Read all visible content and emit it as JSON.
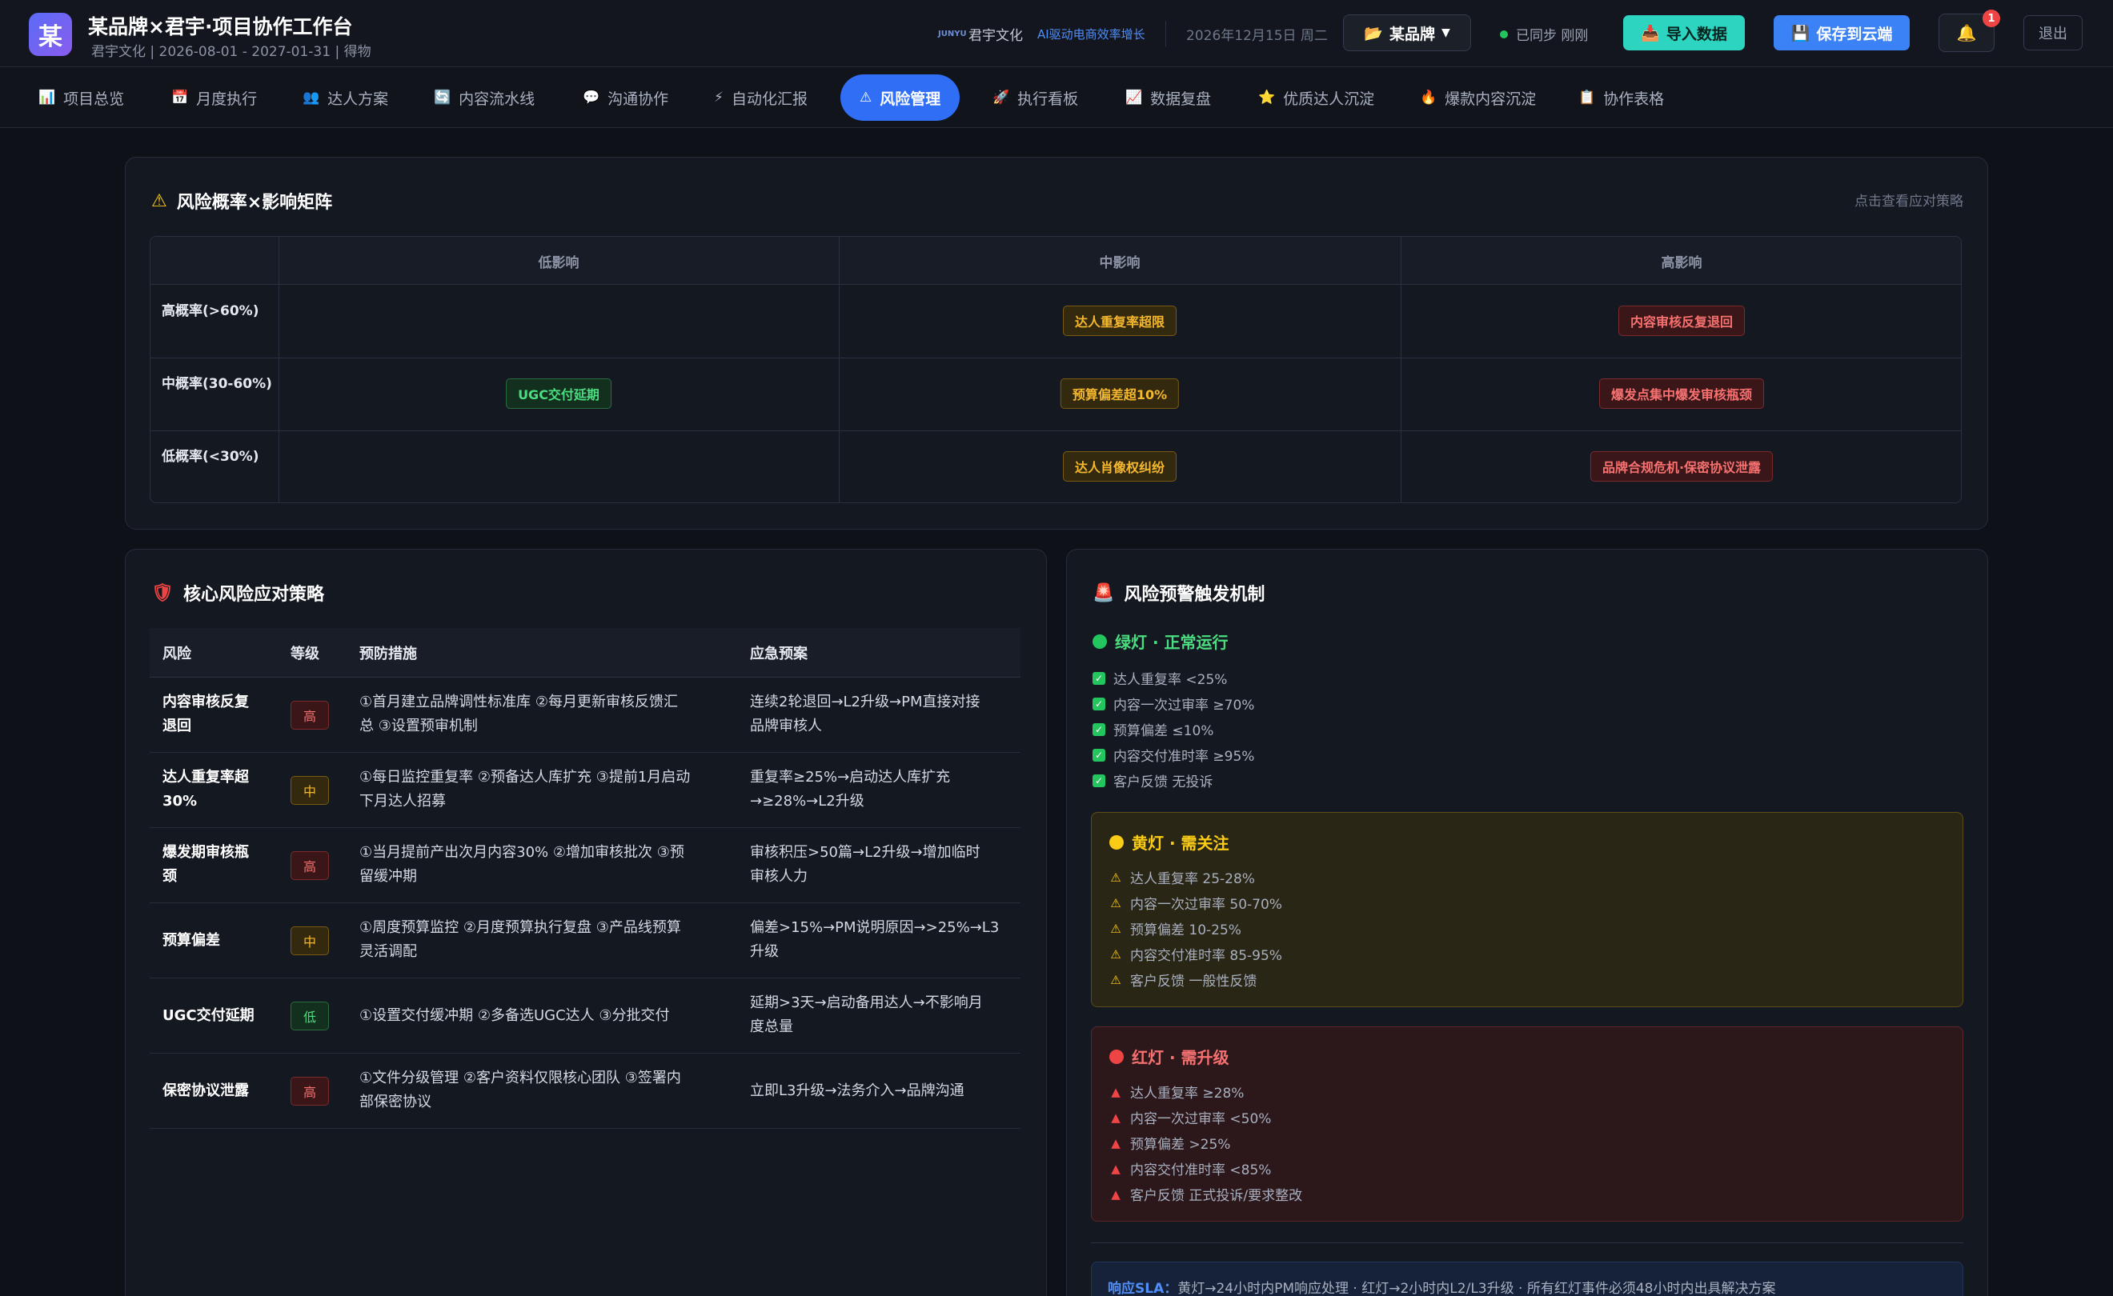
{
  "header": {
    "logo_char": "某",
    "title": "某品牌×君宇·项目协作工作台",
    "subtitle": "君宇文化 | 2026-08-01 - 2027-01-31 | 得物",
    "brand_mini": "JUNYU",
    "company": "君宇文化",
    "tagline": "AI驱动电商效率增长",
    "date": "2026年12月15日 周二",
    "brand_select": "某品牌",
    "sync_status": "已同步 刚刚",
    "import_label": "导入数据",
    "save_label": "保存到云端",
    "notif_count": "1",
    "logout_label": "退出"
  },
  "nav": {
    "tabs": [
      {
        "icon": "📊",
        "label": "项目总览"
      },
      {
        "icon": "📅",
        "label": "月度执行"
      },
      {
        "icon": "👥",
        "label": "达人方案"
      },
      {
        "icon": "🔄",
        "label": "内容流水线"
      },
      {
        "icon": "💬",
        "label": "沟通协作"
      },
      {
        "icon": "⚡",
        "label": "自动化汇报"
      },
      {
        "icon": "⚠",
        "label": "风险管理"
      },
      {
        "icon": "🚀",
        "label": "执行看板"
      },
      {
        "icon": "📈",
        "label": "数据复盘"
      },
      {
        "icon": "⭐",
        "label": "优质达人沉淀"
      },
      {
        "icon": "🔥",
        "label": "爆款内容沉淀"
      },
      {
        "icon": "📋",
        "label": "协作表格"
      }
    ],
    "active_index": 6
  },
  "matrix": {
    "title": "风险概率×影响矩阵",
    "link": "点击查看应对策略",
    "col_headers": [
      "低影响",
      "中影响",
      "高影响"
    ],
    "rows": [
      {
        "label": "高概率(>60%)",
        "cells": [
          "",
          "达人重复率超限",
          "内容审核反复退回"
        ]
      },
      {
        "label": "中概率(30-60%)",
        "cells": [
          "UGC交付延期",
          "预算偏差超10%",
          "爆发点集中爆发审核瓶颈"
        ]
      },
      {
        "label": "低概率(<30%)",
        "cells": [
          "",
          "达人肖像权纠纷",
          "品牌合规危机·保密协议泄露"
        ]
      }
    ]
  },
  "strategy": {
    "title": "核心风险应对策略",
    "headers": [
      "风险",
      "等级",
      "预防措施",
      "应急预案"
    ],
    "rows": [
      {
        "risk_l1": "内容审核反复",
        "risk_l2": "退回",
        "level": "高",
        "level_class": "high",
        "prev_l1": "①首月建立品牌调性标准库 ②每月更新审核反馈汇",
        "prev_l2": "总 ③设置预审机制",
        "plan_l1": "连续2轮退回→L2升级→PM直接对接",
        "plan_l2": "品牌审核人"
      },
      {
        "risk_l1": "达人重复率超",
        "risk_l2": "30%",
        "level": "中",
        "level_class": "mid",
        "prev_l1": "①每日监控重复率 ②预备达人库扩充 ③提前1月启动",
        "prev_l2": "下月达人招募",
        "plan_l1": "重复率≥25%→启动达人库扩充",
        "plan_l2": "→≥28%→L2升级"
      },
      {
        "risk_l1": "爆发期审核瓶",
        "risk_l2": "颈",
        "level": "高",
        "level_class": "high",
        "prev_l1": "①当月提前产出次月内容30% ②增加审核批次 ③预",
        "prev_l2": "留缓冲期",
        "plan_l1": "审核积压>50篇→L2升级→增加临时",
        "plan_l2": "审核人力"
      },
      {
        "risk_l1": "预算偏差",
        "risk_l2": "",
        "level": "中",
        "level_class": "mid",
        "prev_l1": "①周度预算监控 ②月度预算执行复盘 ③产品线预算",
        "prev_l2": "灵活调配",
        "plan_l1": "偏差>15%→PM说明原因→>25%→L3",
        "plan_l2": "升级"
      },
      {
        "risk_l1": "UGC交付延期",
        "risk_l2": "",
        "level": "低",
        "level_class": "low",
        "prev_l1": "①设置交付缓冲期 ②多备选UGC达人 ③分批交付",
        "prev_l2": "",
        "plan_l1": "延期>3天→启动备用达人→不影响月",
        "plan_l2": "度总量"
      },
      {
        "risk_l1": "保密协议泄露",
        "risk_l2": "",
        "level": "高",
        "level_class": "high",
        "prev_l1": "①文件分级管理 ②客户资料仅限核心团队 ③签署内",
        "prev_l2": "部保密协议",
        "plan_l1": "立即L3升级→法务介入→品牌沟通",
        "plan_l2": ""
      }
    ]
  },
  "warning": {
    "title": "风险预警触发机制",
    "green": {
      "title": "绿灯 · 正常运行",
      "color": "#22c55e",
      "items": [
        "达人重复率 <25%",
        "内容一次过审率 ≥70%",
        "预算偏差 ≤10%",
        "内容交付准时率 ≥95%",
        "客户反馈 无投诉"
      ]
    },
    "yellow": {
      "title": "黄灯 · 需关注",
      "color": "#facc15",
      "items": [
        "达人重复率 25-28%",
        "内容一次过审率 50-70%",
        "预算偏差 10-25%",
        "内容交付准时率 85-95%",
        "客户反馈 一般性反馈"
      ]
    },
    "red": {
      "title": "红灯 · 需升级",
      "color": "#ef4444",
      "items": [
        "达人重复率 ≥28%",
        "内容一次过审率 <50%",
        "预算偏差 >25%",
        "内容交付准时率 <85%",
        "客户反馈 正式投诉/要求整改"
      ]
    },
    "sla_label": "响应SLA：",
    "sla_text": "黄灯→24小时内PM响应处理 · 红灯→2小时内L2/L3升级 · 所有红灯事件必须48小时内出具解决方案"
  }
}
